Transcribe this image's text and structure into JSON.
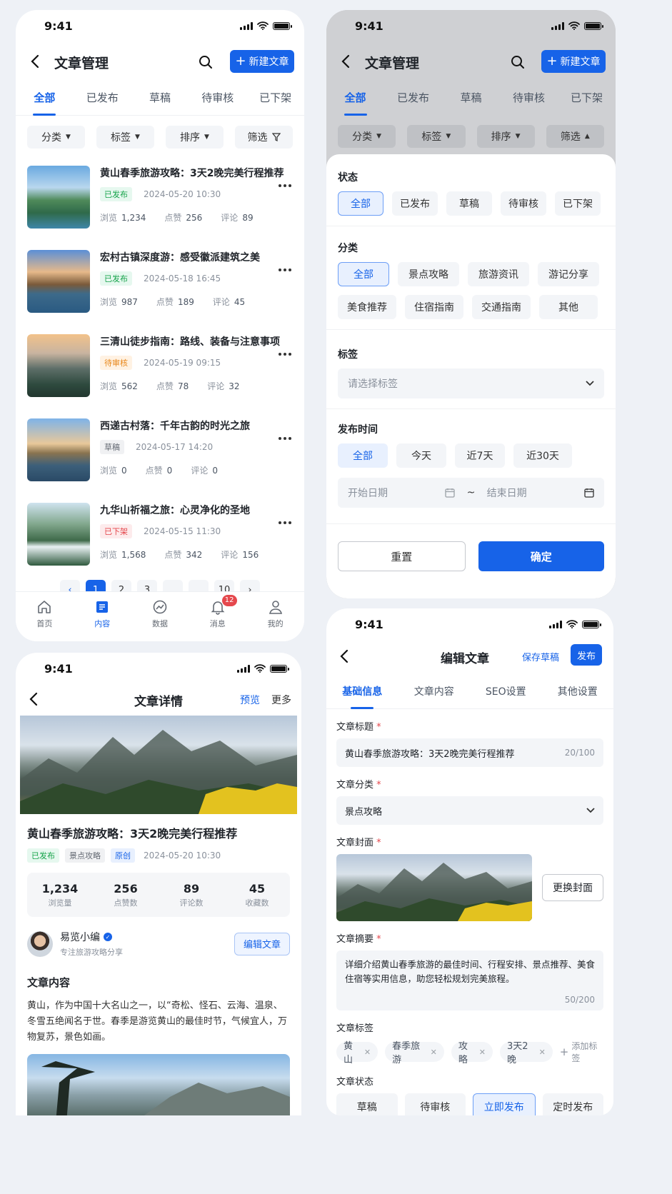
{
  "status": {
    "time": "9:41"
  },
  "screen1": {
    "title": "文章管理",
    "new_btn": "新建文章",
    "tabs": [
      "全部",
      "已发布",
      "草稿",
      "待审核",
      "已下架"
    ],
    "filters": [
      "分类",
      "标签",
      "排序",
      "筛选"
    ],
    "articles": [
      {
        "title": "黄山春季旅游攻略：3天2晚完美行程推荐",
        "status": "已发布",
        "date": "2024-05-20 10:30",
        "views_label": "浏览",
        "views": "1,234",
        "likes_label": "点赞",
        "likes": "256",
        "comments_label": "评论",
        "comments": "89"
      },
      {
        "title": "宏村古镇深度游：感受徽派建筑之美",
        "status": "已发布",
        "date": "2024-05-18 16:45",
        "views_label": "浏览",
        "views": "987",
        "likes_label": "点赞",
        "likes": "189",
        "comments_label": "评论",
        "comments": "45"
      },
      {
        "title": "三清山徒步指南：路线、装备与注意事项",
        "status": "待审核",
        "date": "2024-05-19 09:15",
        "views_label": "浏览",
        "views": "562",
        "likes_label": "点赞",
        "likes": "78",
        "comments_label": "评论",
        "comments": "32"
      },
      {
        "title": "西递古村落：千年古韵的时光之旅",
        "status": "草稿",
        "date": "2024-05-17 14:20",
        "views_label": "浏览",
        "views": "0",
        "likes_label": "点赞",
        "likes": "0",
        "comments_label": "评论",
        "comments": "0"
      },
      {
        "title": "九华山祈福之旅：心灵净化的圣地",
        "status": "已下架",
        "date": "2024-05-15 11:30",
        "views_label": "浏览",
        "views": "1,568",
        "likes_label": "点赞",
        "likes": "342",
        "comments_label": "评论",
        "comments": "156"
      }
    ],
    "pagination": [
      "1",
      "2",
      "3",
      "...",
      "...",
      "10"
    ],
    "tabbar": [
      {
        "label": "首页"
      },
      {
        "label": "内容"
      },
      {
        "label": "数据"
      },
      {
        "label": "消息",
        "badge": "12"
      },
      {
        "label": "我的"
      }
    ]
  },
  "screen2": {
    "title": "文章管理",
    "new_btn": "新建文章",
    "tabs": [
      "全部",
      "已发布",
      "草稿",
      "待审核",
      "已下架"
    ],
    "filters": [
      "分类",
      "标签",
      "排序",
      "筛选"
    ],
    "status_label": "状态",
    "status_opts": [
      "全部",
      "已发布",
      "草稿",
      "待审核",
      "已下架"
    ],
    "category_label": "分类",
    "category_opts": [
      "全部",
      "景点攻略",
      "旅游资讯",
      "游记分享",
      "美食推荐",
      "住宿指南",
      "交通指南",
      "其他"
    ],
    "tag_label": "标签",
    "tag_placeholder": "请选择标签",
    "time_label": "发布时间",
    "time_opts": [
      "全部",
      "今天",
      "近7天",
      "近30天"
    ],
    "start_date": "开始日期",
    "tilde": "~",
    "end_date": "结束日期",
    "reset": "重置",
    "confirm": "确定"
  },
  "screen3": {
    "title": "文章详情",
    "preview": "预览",
    "more": "更多",
    "article_title": "黄山春季旅游攻略：3天2晚完美行程推荐",
    "badges": [
      "已发布",
      "景点攻略",
      "原创"
    ],
    "date": "2024-05-20 10:30",
    "stats": [
      {
        "value": "1,234",
        "label": "浏览量"
      },
      {
        "value": "256",
        "label": "点赞数"
      },
      {
        "value": "89",
        "label": "评论数"
      },
      {
        "value": "45",
        "label": "收藏数"
      }
    ],
    "author": "易览小编",
    "author_desc": "专注旅游攻略分享",
    "edit": "编辑文章",
    "content_title": "文章内容",
    "content": "黄山，作为中国十大名山之一，以“奇松、怪石、云海、温泉、冬雪五绝闻名于世。春季是游览黄山的最佳时节，气候宜人，万物复苏，景色如画。"
  },
  "screen4": {
    "title": "编辑文章",
    "save_draft": "保存草稿",
    "publish": "发布",
    "tabs": [
      "基础信息",
      "文章内容",
      "SEO设置",
      "其他设置"
    ],
    "f_title_label": "文章标题",
    "f_title_value": "黄山春季旅游攻略：3天2晚完美行程推荐",
    "f_title_count": "20/100",
    "f_cat_label": "文章分类",
    "f_cat_value": "景点攻略",
    "f_cover_label": "文章封面",
    "change_cover": "更换封面",
    "f_summary_label": "文章摘要",
    "f_summary_value": "详细介绍黄山春季旅游的最佳时间、行程安排、景点推荐、美食住宿等实用信息，助您轻松规划完美旅程。",
    "f_summary_count": "50/200",
    "f_tags_label": "文章标签",
    "tags": [
      "黄山",
      "春季旅游",
      "攻略",
      "3天2晚"
    ],
    "add_tag": "添加标签",
    "f_status_label": "文章状态",
    "status_opts": [
      "草稿",
      "待审核",
      "立即发布",
      "定时发布"
    ],
    "required": "*"
  },
  "colors": {
    "primary": "#1763e8",
    "published": "#16a34a",
    "review": "#e8871a",
    "offline": "#e5484d"
  }
}
